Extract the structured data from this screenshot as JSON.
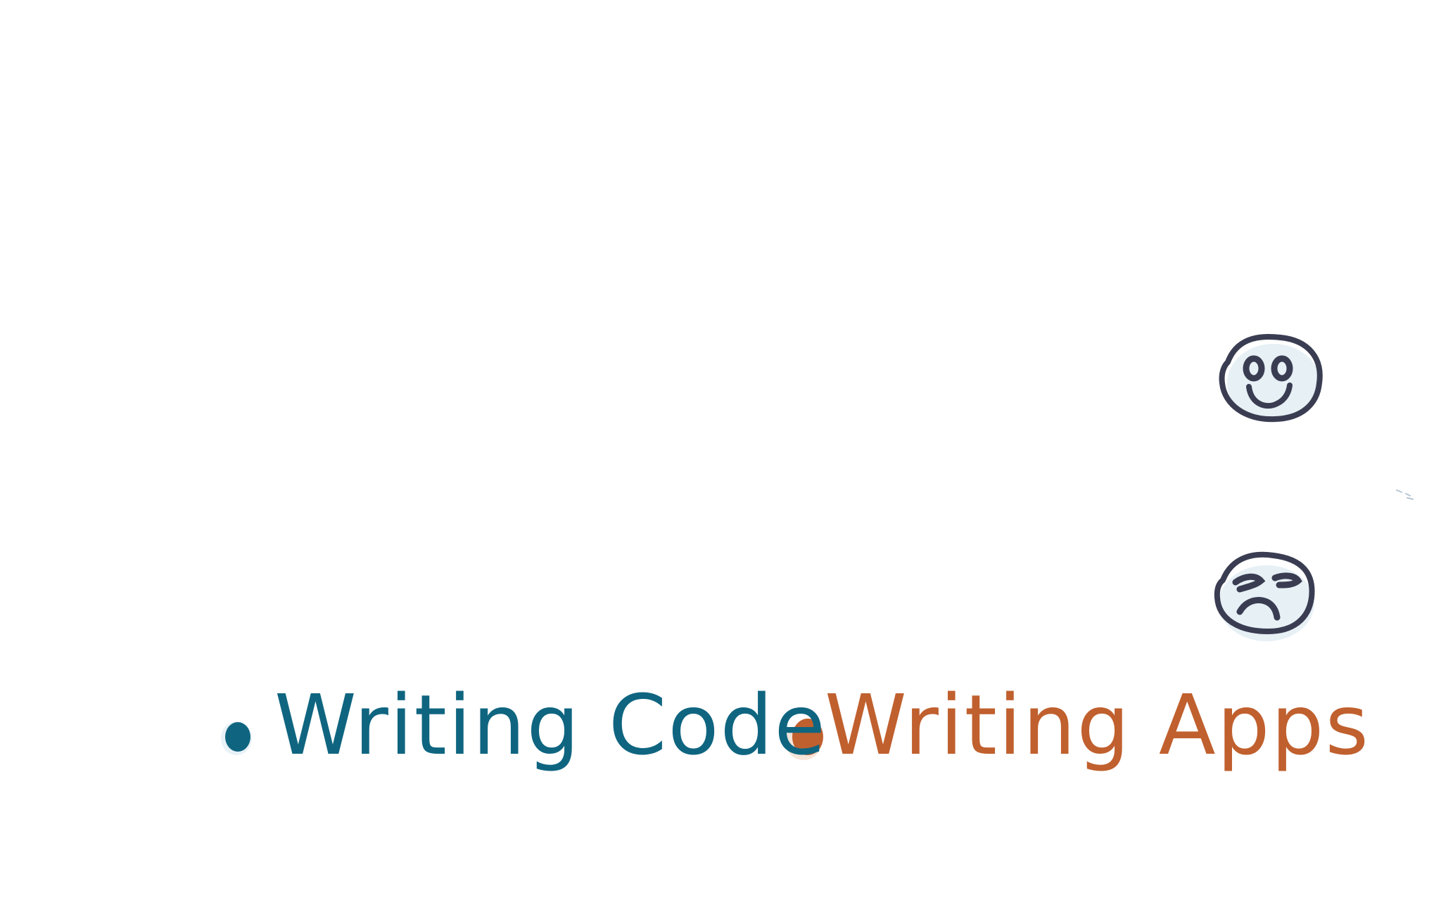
{
  "colors": {
    "background": "#ffffff",
    "code": "#0f6580",
    "apps": "#c0602e",
    "face": "#3a3d52",
    "face_shadow": "#dbe9f1"
  },
  "faces": {
    "happy": {
      "icon": "smiley-face-icon"
    },
    "sad": {
      "icon": "frowning-face-icon"
    }
  },
  "legend": {
    "code_label": "Writing Code",
    "apps_label": "Writing Apps"
  }
}
